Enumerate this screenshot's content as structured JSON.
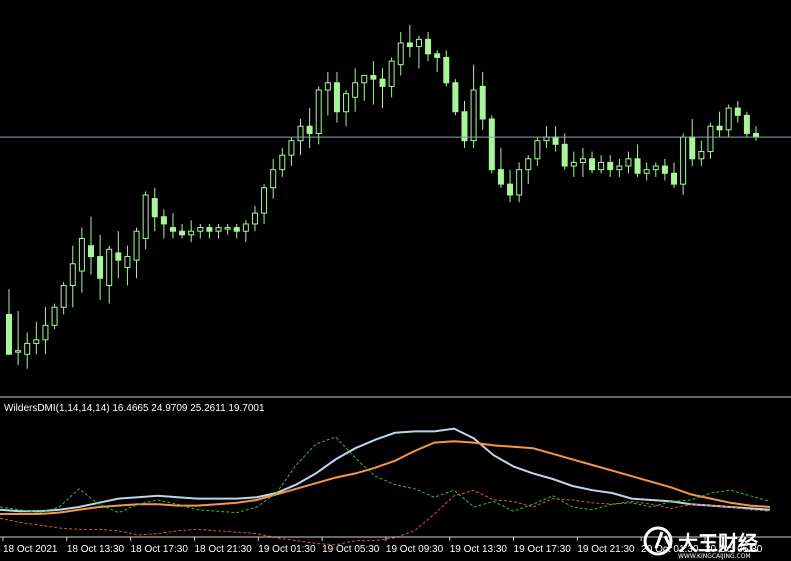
{
  "colors": {
    "background": "#000000",
    "candle": "#a9f59a",
    "separator": "#cfcfcf",
    "price_line": "#8fa4b8",
    "di_plus": "#2fbf2f",
    "di_minus": "#e0562a",
    "adx": "#f79646",
    "adxr": "#b8d8ea"
  },
  "indicator": {
    "label": "WildersDMI(1,14,14,14) 16.4665 24.9709 25.2611 19.7001"
  },
  "watermark": {
    "brand": "大王财经",
    "url": "WWW.KINGCAIJING.COM",
    "logo_icon": "kingcaijing-logo-icon"
  },
  "chart_data": [
    {
      "type": "candlestick",
      "title": "",
      "x_axis_labels": [
        "18 Oct 2021",
        "18 Oct 13:30",
        "18 Oct 17:30",
        "18 Oct 21:30",
        "19 Oct 01:30",
        "19 Oct 05:30",
        "19 Oct 09:30",
        "19 Oct 13:30",
        "19 Oct 17:30",
        "19 Oct 21:30",
        "20 Oct 01:30",
        "20 Oct 05:30"
      ],
      "price_scale": [
        0,
        100
      ],
      "horizontal_line_level": 66,
      "candles": [
        [
          17,
          24,
          9,
          6
        ],
        [
          7,
          18,
          3,
          7
        ],
        [
          6,
          12,
          2,
          9
        ],
        [
          9,
          15,
          6,
          10
        ],
        [
          10,
          19,
          6,
          14
        ],
        [
          14,
          20,
          13,
          19
        ],
        [
          19,
          26,
          17,
          25
        ],
        [
          25,
          36,
          19,
          31
        ],
        [
          29,
          41,
          23,
          38
        ],
        [
          36,
          44,
          28,
          33
        ],
        [
          33,
          39,
          21,
          27
        ],
        [
          25,
          36,
          20,
          35
        ],
        [
          34,
          40,
          27,
          32
        ],
        [
          30,
          36,
          25,
          33
        ],
        [
          32,
          41,
          27,
          40
        ],
        [
          38,
          51,
          35,
          50
        ],
        [
          49,
          52,
          40,
          44
        ],
        [
          44,
          46,
          38,
          42
        ],
        [
          41,
          45,
          38,
          40
        ],
        [
          40,
          42,
          38,
          39
        ],
        [
          39,
          43,
          37,
          40
        ],
        [
          40,
          42,
          38,
          41
        ],
        [
          41,
          42,
          38,
          40
        ],
        [
          40,
          42,
          38,
          41
        ],
        [
          41,
          42,
          39,
          41
        ],
        [
          41,
          42,
          38,
          40
        ],
        [
          40,
          43,
          37,
          42
        ],
        [
          42,
          47,
          40,
          45
        ],
        [
          45,
          53,
          42,
          52
        ],
        [
          52,
          60,
          49,
          57
        ],
        [
          57,
          63,
          55,
          61
        ],
        [
          61,
          66,
          58,
          65
        ],
        [
          65,
          71,
          61,
          69
        ],
        [
          69,
          74,
          63,
          67
        ],
        [
          67,
          80,
          64,
          79
        ],
        [
          79,
          84,
          72,
          81
        ],
        [
          81,
          84,
          70,
          73
        ],
        [
          73,
          79,
          69,
          78
        ],
        [
          77,
          85,
          73,
          81
        ],
        [
          81,
          83,
          76,
          83
        ],
        [
          83,
          87,
          75,
          82
        ],
        [
          82,
          85,
          74,
          80
        ],
        [
          80,
          88,
          77,
          87
        ],
        [
          86,
          95,
          83,
          92
        ],
        [
          92,
          97,
          88,
          91
        ],
        [
          91,
          94,
          85,
          93
        ],
        [
          93,
          95,
          87,
          89
        ],
        [
          89,
          90,
          84,
          88
        ],
        [
          88,
          90,
          80,
          81
        ],
        [
          81,
          82,
          72,
          73
        ],
        [
          73,
          76,
          63,
          65
        ],
        [
          65,
          86,
          63,
          79
        ],
        [
          80,
          84,
          68,
          71
        ],
        [
          71,
          72,
          56,
          57
        ],
        [
          57,
          63,
          52,
          53
        ],
        [
          53,
          57,
          48,
          50
        ],
        [
          50,
          59,
          48,
          57
        ],
        [
          57,
          61,
          53,
          60
        ],
        [
          60,
          66,
          58,
          65
        ],
        [
          65,
          69,
          63,
          66
        ],
        [
          66,
          69,
          62,
          64
        ],
        [
          64,
          67,
          57,
          58
        ],
        [
          58,
          62,
          55,
          59
        ],
        [
          59,
          63,
          55,
          60
        ],
        [
          60,
          62,
          56,
          57
        ],
        [
          57,
          61,
          56,
          59
        ],
        [
          59,
          61,
          55,
          57
        ],
        [
          57,
          60,
          55,
          58
        ],
        [
          58,
          62,
          56,
          60
        ],
        [
          60,
          64,
          55,
          56
        ],
        [
          56,
          59,
          54,
          57
        ],
        [
          57,
          59,
          55,
          58
        ],
        [
          58,
          60,
          54,
          56
        ],
        [
          56,
          59,
          52,
          53
        ],
        [
          53,
          67,
          50,
          66
        ],
        [
          66,
          71,
          58,
          60
        ],
        [
          60,
          65,
          58,
          62
        ],
        [
          62,
          70,
          60,
          69
        ],
        [
          69,
          73,
          66,
          68
        ],
        [
          68,
          75,
          66,
          74
        ],
        [
          74,
          76,
          70,
          72
        ],
        [
          72,
          73,
          66,
          67
        ],
        [
          67,
          69,
          65,
          66
        ]
      ]
    },
    {
      "type": "line",
      "title": "WildersDMI(1,14,14,14)",
      "ylim": [
        0,
        100
      ],
      "series": [
        {
          "color": "#b8d8ea",
          "style": "solid",
          "values": [
            18,
            17,
            17,
            18,
            20,
            23,
            26,
            27,
            28,
            27,
            26,
            26,
            26,
            27,
            30,
            36,
            44,
            54,
            62,
            68,
            73,
            74,
            74,
            76,
            69,
            57,
            49,
            44,
            40,
            35,
            32,
            30,
            26,
            25,
            24,
            22,
            21,
            20,
            19,
            18
          ]
        },
        {
          "color": "#f79646",
          "style": "solid",
          "values": [
            15,
            15,
            15,
            16,
            18,
            20,
            21,
            22,
            22,
            21,
            21,
            22,
            23,
            25,
            29,
            33,
            37,
            41,
            44,
            48,
            53,
            60,
            66,
            67,
            66,
            64,
            63,
            62,
            58,
            54,
            50,
            46,
            42,
            38,
            34,
            29,
            26,
            23,
            21,
            20
          ]
        },
        {
          "color": "#2fbf2f",
          "style": "dashed",
          "values": [
            20,
            18,
            16,
            20,
            33,
            22,
            16,
            22,
            25,
            22,
            18,
            17,
            16,
            20,
            30,
            50,
            65,
            70,
            55,
            42,
            36,
            33,
            27,
            32,
            20,
            24,
            17,
            22,
            28,
            20,
            18,
            22,
            23,
            20,
            24,
            25,
            30,
            32,
            28,
            24
          ]
        },
        {
          "color": "#e0562a",
          "style": "dashed",
          "values": [
            12,
            9,
            7,
            5,
            4,
            4,
            3,
            0,
            1,
            3,
            4,
            3,
            2,
            1,
            -2,
            -4,
            -6,
            -7,
            -4,
            -4,
            -2,
            3,
            15,
            28,
            32,
            25,
            24,
            20,
            26,
            25,
            23,
            22,
            24,
            22,
            19,
            22,
            21,
            20,
            18,
            17
          ]
        }
      ]
    }
  ]
}
